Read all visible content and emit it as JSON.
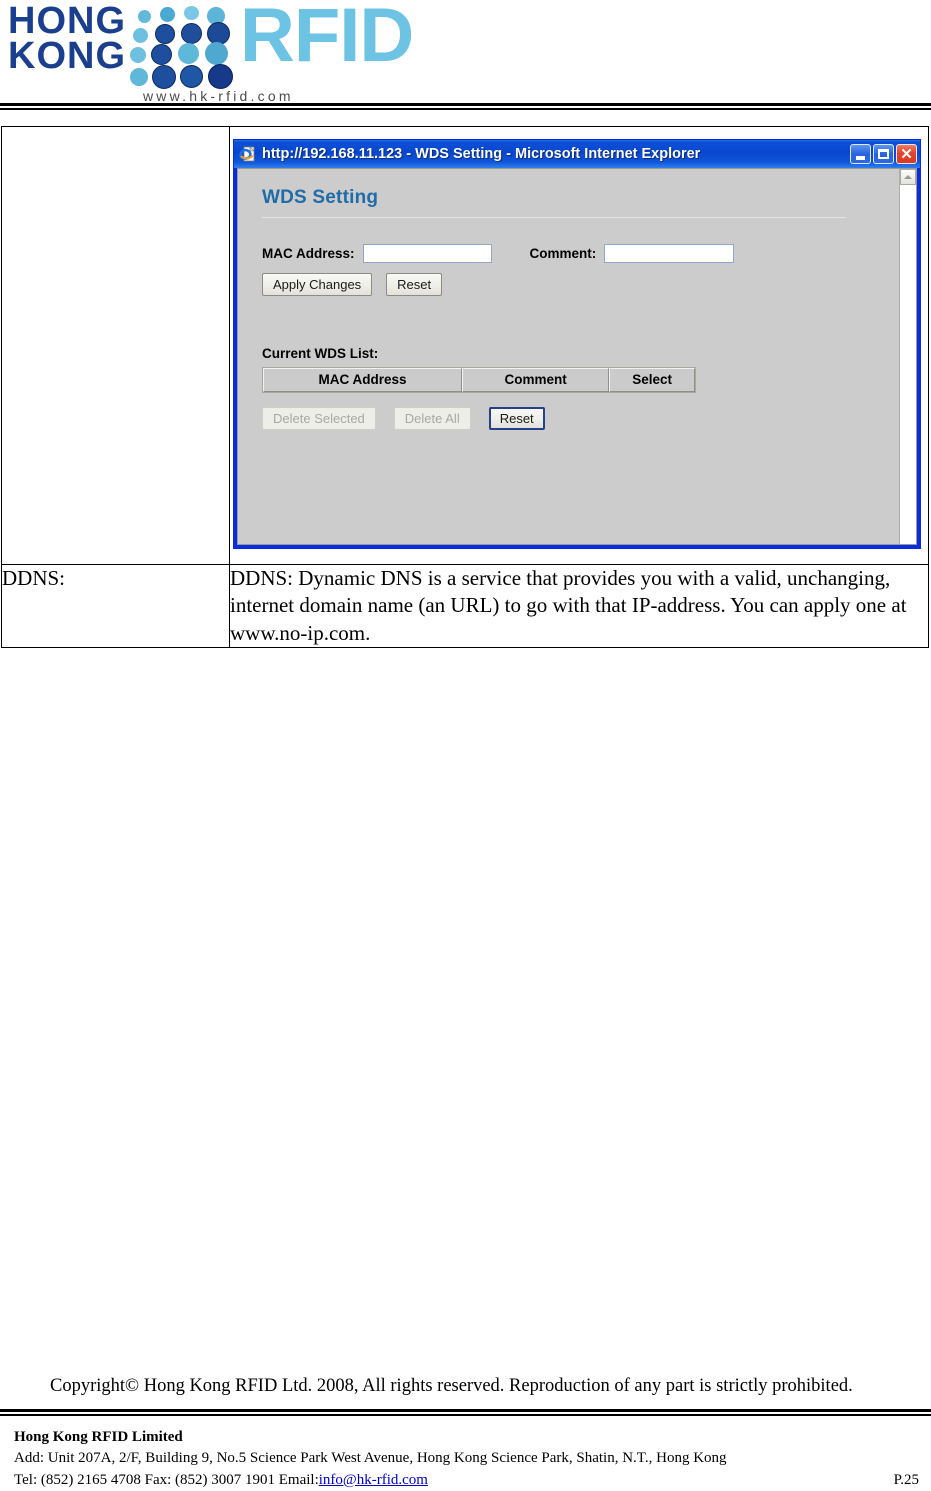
{
  "header": {
    "logo_line1": "HONG",
    "logo_line2": "KONG",
    "logo_brand": "RFID",
    "logo_url": "www.hk-rfid.com",
    "navy": "#1b3f8f",
    "light_blue": "#6cc3e4"
  },
  "table": {
    "row1_label": "",
    "row2_label": "DDNS:",
    "row2_text": "DDNS:  Dynamic DNS is a service that provides you with a valid, unchanging, internet domain name (an URL) to go with that IP-address. You can apply one at www.no-ip.com."
  },
  "browser": {
    "title": "http://192.168.11.123 - WDS Setting - Microsoft Internet Explorer",
    "icon": "internet-explorer-icon",
    "minimize_label": "",
    "maximize_label": "",
    "close_label": "✕",
    "titlebar_color": "#0a46cf"
  },
  "page": {
    "heading": "WDS Setting",
    "heading_color": "#1f6ca8",
    "mac_label": "MAC Address:",
    "mac_value": "",
    "comment_label": "Comment:",
    "comment_value": "",
    "apply_label": "Apply Changes",
    "reset_label": "Reset",
    "list_title": "Current WDS List:",
    "list_headers": [
      "MAC Address",
      "Comment",
      "Select"
    ],
    "list_rows": [],
    "delete_selected_label": "Delete Selected",
    "delete_all_label": "Delete All",
    "reset2_label": "Reset"
  },
  "footer": {
    "copyright": "Copyright© Hong Kong RFID Ltd. 2008, All rights reserved. Reproduction of any part is strictly prohibited.",
    "company": "Hong Kong RFID Limited",
    "address": "Add: Unit 207A, 2/F, Building 9, No.5 Science Park West Avenue, Hong Kong Science Park, Shatin, N.T., Hong Kong",
    "contact_prefix": "Tel: (852) 2165 4708   Fax: (852) 3007 1901   Email: ",
    "email": "info@hk-rfid.com",
    "page_number": "P.25"
  }
}
